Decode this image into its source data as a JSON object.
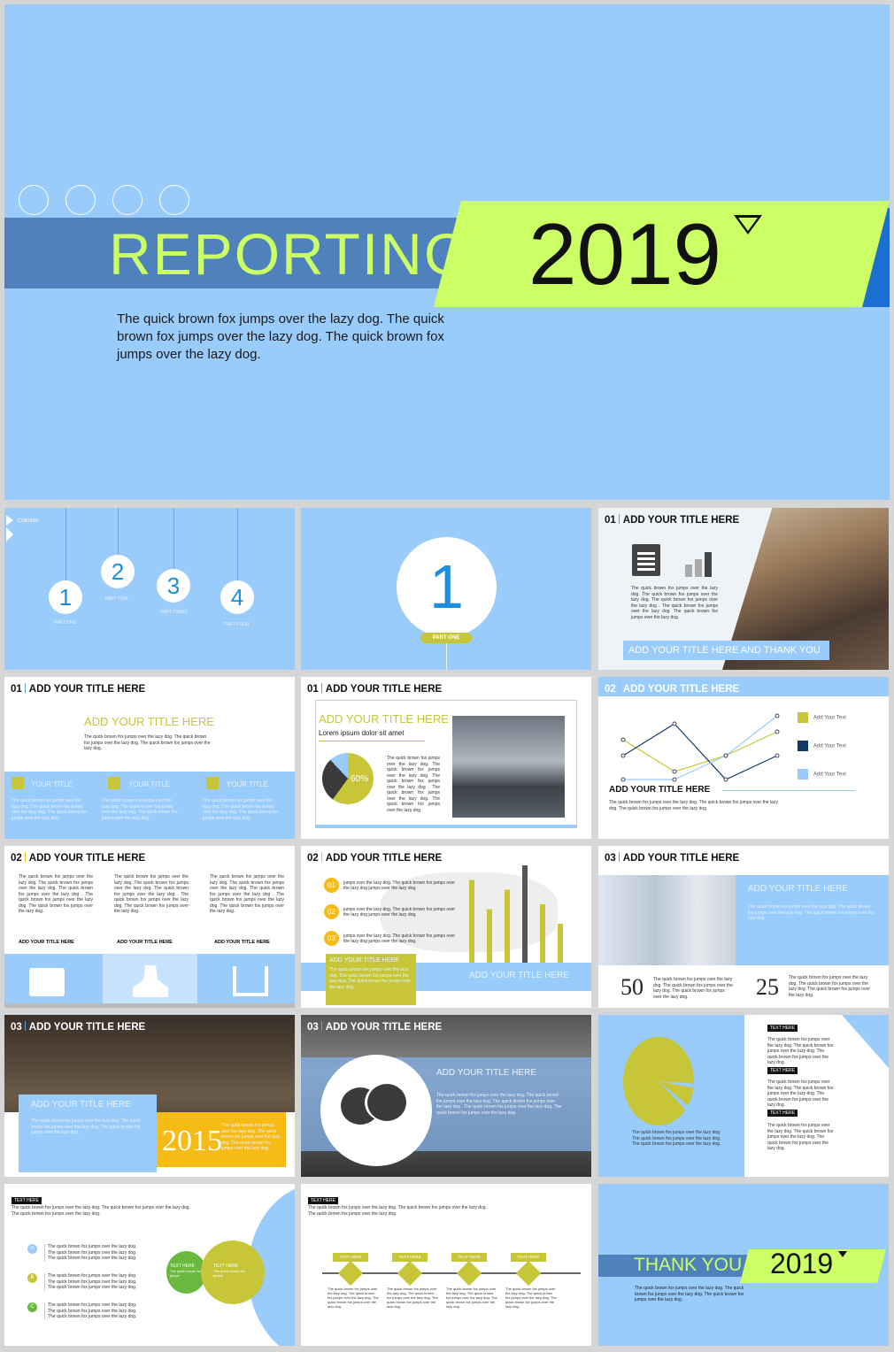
{
  "colors": {
    "light_blue": "#99cbfb",
    "band_blue": "#4f81bd",
    "lime": "#ccff66",
    "olive": "#c6c638",
    "yellow": "#f7bb16",
    "dark": "#3a3a3a"
  },
  "fox": "The quick brown fox jumps over the lazy dog. The quick brown fox jumps over the lazy dog. The quick brown fox jumps over the lazy dog.",
  "fox_long": "The quick brown fox jumps over the lazy dog. The quick brown fox jumps over the lazy dog. The quick brown fox jumps over the lazy dog . The quick brown fox jumps over the lazy dog. The quick brown fox jumps over the lazy dog.",
  "cover": {
    "title": "REPORTING",
    "year": "2019",
    "body": "The quick brown fox jumps over the lazy dog. The quick brown fox jumps over the lazy dog. The quick brown fox jumps over the lazy dog."
  },
  "add_title": "ADD YOUR TITLE HERE",
  "s_content": {
    "label": "CONTENT",
    "items": [
      {
        "num": "1",
        "label": "PART ONE"
      },
      {
        "num": "2",
        "label": "PART TOW"
      },
      {
        "num": "3",
        "label": "PART THREE"
      },
      {
        "num": "4",
        "label": "PART FOUR"
      }
    ]
  },
  "s_part": {
    "num": "1",
    "label": "PART ONE"
  },
  "s3": {
    "num": "01",
    "banner": "ADD YOUR TITLE HERE AND THANK YOU"
  },
  "s4": {
    "num": "01",
    "cols": [
      "YOUR TITLE",
      "YOUR TITLE",
      "YOUR TITLE"
    ]
  },
  "s5": {
    "num": "01",
    "sub": "Lorem ipsum dolor sit amet",
    "pct": "60%",
    "pie_value": 60
  },
  "s6": {
    "num": "02",
    "legend": [
      "Add Your Text",
      "Add Your Text",
      "Add Your Text"
    ],
    "series": [
      [
        3,
        1,
        2,
        3.5
      ],
      [
        2,
        4,
        0.5,
        2
      ],
      [
        0.5,
        0.5,
        2,
        4.5
      ]
    ]
  },
  "s7": {
    "num": "02",
    "col_title": "ADD YOUR TITLE HERE"
  },
  "s8": {
    "num": "02",
    "items": [
      "01",
      "02",
      "03"
    ],
    "item_text": "jumps over the lazy dog. The quick brown fox jumps over the lazy dog jumps over the lazy dog.",
    "bars": [
      85,
      55,
      75,
      100,
      60,
      40
    ],
    "box_title": "ADD YOUR TITLE HERE"
  },
  "s9": {
    "num": "03",
    "stat1": "50",
    "stat2": "25"
  },
  "s10": {
    "num": "03",
    "year": "2015"
  },
  "s11": {
    "num": "03"
  },
  "s12": {
    "tag": "TEXT HERE"
  },
  "s13": {
    "tag": "TEXT HERE",
    "letters": [
      "A",
      "B",
      "C"
    ],
    "venn": "TEXT HERE",
    "venn_sub": "The quick brown fox jumps"
  },
  "s14": {
    "tag": "TEXT HERE",
    "steps": [
      "TEXT HERE",
      "TEXT HERE",
      "TEXT HERE",
      "TEXT HERE"
    ]
  },
  "s15": {
    "title": "THANK YOU",
    "year": "2019"
  }
}
